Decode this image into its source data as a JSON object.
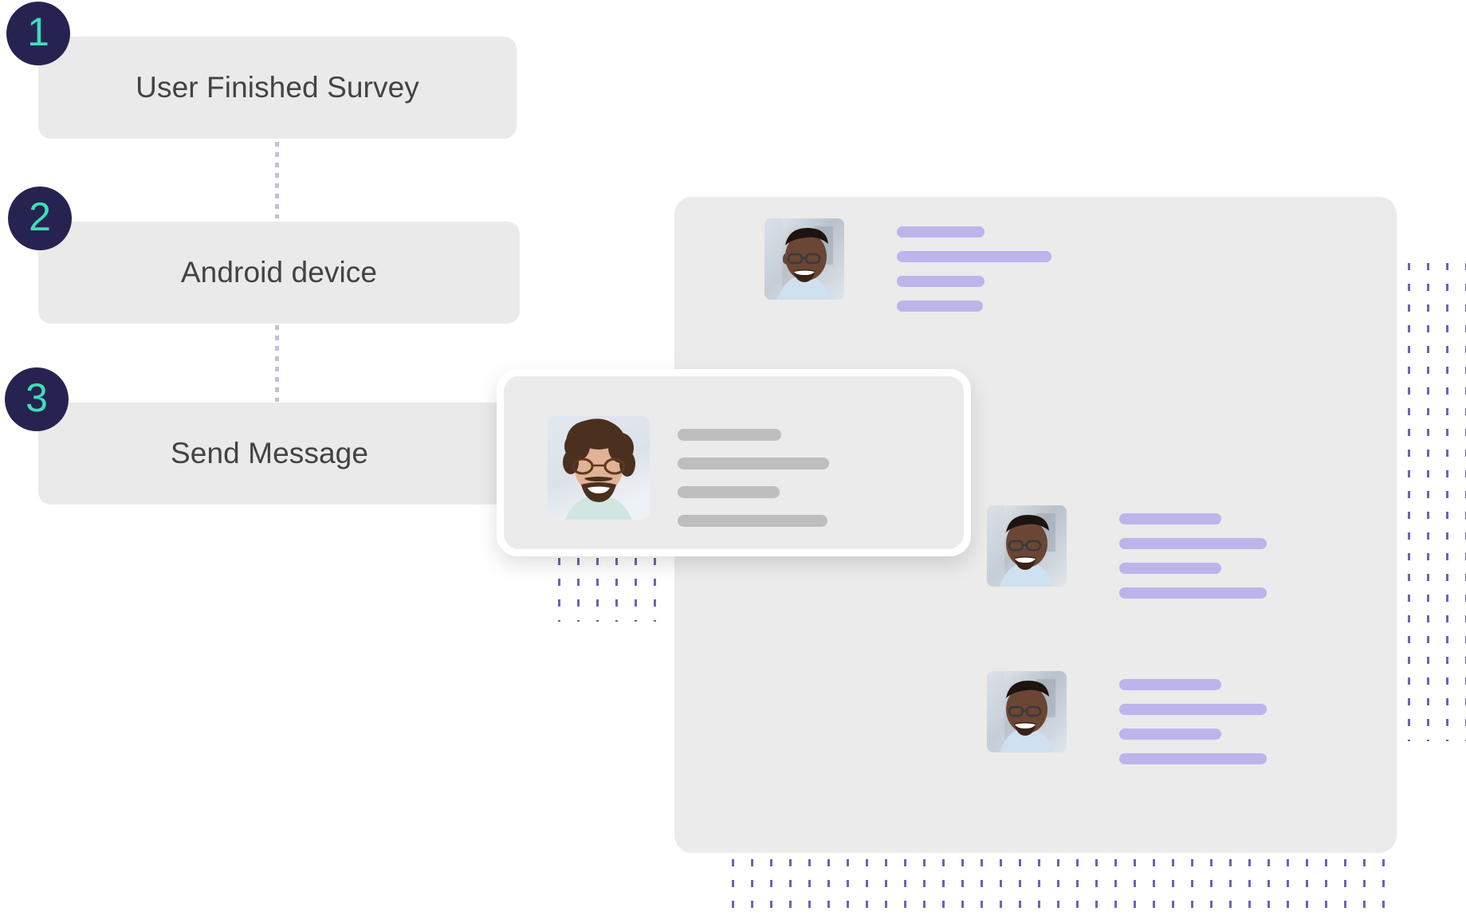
{
  "steps": [
    {
      "number": "1",
      "label": "User Finished Survey"
    },
    {
      "number": "2",
      "label": "Android device"
    },
    {
      "number": "3",
      "label": "Send Message"
    }
  ],
  "colors": {
    "badge_background": "#272350",
    "badge_number": "#3ce0b8",
    "step_box": "#eaeaea",
    "step_label": "#434343",
    "panel_background": "#ebebeb",
    "message_line": "#bdb4ec",
    "card_line": "#bebebe",
    "dot_pattern": "#6b63b5",
    "connector": "#c3c0de",
    "card_border": "#ffffff"
  },
  "message_panel": {
    "name": "message-list-panel",
    "rows": [
      {
        "avatar": "avatar-person-smiling-glasses",
        "line_widths": [
          110,
          194,
          110,
          108
        ]
      },
      {
        "avatar": "avatar-person-smiling-glasses",
        "line_widths": [
          128,
          185,
          128,
          185
        ]
      },
      {
        "avatar": "avatar-person-smiling-glasses",
        "line_widths": [
          128,
          185,
          128,
          185
        ]
      }
    ]
  },
  "floating_card": {
    "name": "highlighted-message-card",
    "avatar": "avatar-person-curly-hair-glasses",
    "line_widths": [
      130,
      190,
      128,
      188
    ]
  },
  "decorations": {
    "dots_right": "dot-grid-right",
    "dots_bottom": "dot-grid-bottom",
    "dots_card": "dot-grid-under-card",
    "connector_1": "dotted-connector-step1-step2",
    "connector_2": "dotted-connector-step2-step3"
  }
}
